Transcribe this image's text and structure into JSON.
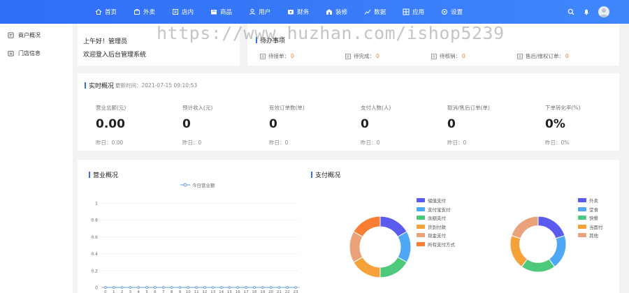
{
  "nav": {
    "items": [
      {
        "label": "首页",
        "icon": "home-icon"
      },
      {
        "label": "外卖",
        "icon": "takeout-icon"
      },
      {
        "label": "店内",
        "icon": "dine-in-icon"
      },
      {
        "label": "商品",
        "icon": "goods-icon"
      },
      {
        "label": "用户",
        "icon": "user-icon"
      },
      {
        "label": "财务",
        "icon": "finance-icon"
      },
      {
        "label": "装修",
        "icon": "decorate-icon"
      },
      {
        "label": "数据",
        "icon": "data-icon"
      },
      {
        "label": "应用",
        "icon": "apps-icon"
      },
      {
        "label": "设置",
        "icon": "settings-icon"
      }
    ]
  },
  "sidebar": {
    "items": [
      {
        "label": "商户概况"
      },
      {
        "label": "门店信息"
      }
    ]
  },
  "welcome": {
    "greeting": "上午好！管理员",
    "subtitle": "欢迎登入后台管理系统"
  },
  "todo": {
    "title": "待办事项",
    "items": [
      {
        "label": "待接单：",
        "value": "0"
      },
      {
        "label": "待完成：",
        "value": "0"
      },
      {
        "label": "待核销：",
        "value": "0"
      },
      {
        "label": "售后/维权订单：",
        "value": "0"
      }
    ]
  },
  "realtime": {
    "title": "实时概况",
    "update_time": "更新时间：2021-07-15 09:10:53",
    "stats": [
      {
        "label": "营业总额(元)",
        "value": "0.00",
        "yesterday": "昨日：0.00"
      },
      {
        "label": "预计收入(元)",
        "value": "0",
        "yesterday": "昨日：0"
      },
      {
        "label": "有效订单数(单)",
        "value": "0",
        "yesterday": "昨日：0"
      },
      {
        "label": "支付人数(人)",
        "value": "0",
        "yesterday": "昨日：0"
      },
      {
        "label": "取消/售后订单(单)",
        "value": "0",
        "yesterday": "昨日：0"
      },
      {
        "label": "下单转化率(%)",
        "value": "0%",
        "yesterday": "昨日：0%"
      }
    ]
  },
  "business": {
    "title": "营业概况"
  },
  "payment": {
    "title": "支付概况"
  },
  "chart_data": [
    {
      "type": "line",
      "series": [
        {
          "name": "今日营业额",
          "values": [
            0,
            0,
            0,
            0,
            0,
            0,
            0,
            0,
            0,
            0,
            0,
            0,
            0,
            0,
            0,
            0,
            0,
            0,
            0,
            0,
            0,
            0,
            0,
            0
          ],
          "color": "#5b9bd5"
        }
      ],
      "x": [
        "0",
        "1",
        "2",
        "3",
        "4",
        "5",
        "6",
        "7",
        "8",
        "9",
        "10",
        "11",
        "12",
        "13",
        "14",
        "15",
        "16",
        "17",
        "18",
        "19",
        "20",
        "21",
        "22",
        "23"
      ],
      "ylim": [
        0,
        1
      ],
      "yticks": [
        "0",
        "0.2",
        "0.4",
        "0.6",
        "0.8",
        "1"
      ],
      "grid": true,
      "legend": "top"
    },
    {
      "type": "pie",
      "donut": true,
      "categories": [
        "储值支付",
        "支付宝支付",
        "余额支付",
        "货到付款",
        "现金支付",
        "所有支付方式"
      ],
      "colors": [
        "#5b5bf0",
        "#4fa8f5",
        "#4cc97a",
        "#f5a23a",
        "#e9a27a",
        "#f97d33"
      ],
      "legend": "left"
    },
    {
      "type": "pie",
      "donut": true,
      "categories": [
        "外卖",
        "堂食",
        "快餐",
        "当面付",
        "其他"
      ],
      "colors": [
        "#5b5bf0",
        "#4fa8f5",
        "#4cc97a",
        "#f5a23a",
        "#e9a27a"
      ],
      "legend": "right"
    }
  ],
  "watermark": "https://www.huzhan.com/ishop5239"
}
